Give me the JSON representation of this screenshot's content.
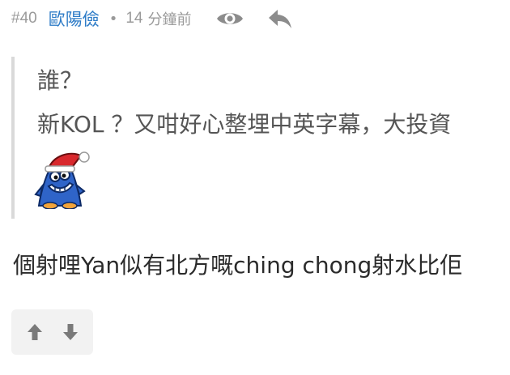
{
  "post": {
    "number": "#40",
    "username": "歐陽儉",
    "separator": "•",
    "time_value": "14",
    "time_unit": "分鐘前",
    "icons": {
      "view": "eye-icon",
      "reply": "reply-arrow-icon"
    },
    "colors": {
      "username": "#2e7cc7",
      "meta": "#9a9a9a",
      "quote_border": "#d9d9d9"
    }
  },
  "quote": {
    "line1": "誰？",
    "line2": "新KOL ？又咁好心整埋中英字幕，大投資",
    "sticker": "blue-santa-hat-monster-sticker"
  },
  "reply": {
    "text": "個射哩Yan似有北方嘅ching chong射水比佢"
  },
  "votes": {
    "up_icon": "thumb-up-arrow-icon",
    "down_icon": "thumb-down-arrow-icon"
  }
}
